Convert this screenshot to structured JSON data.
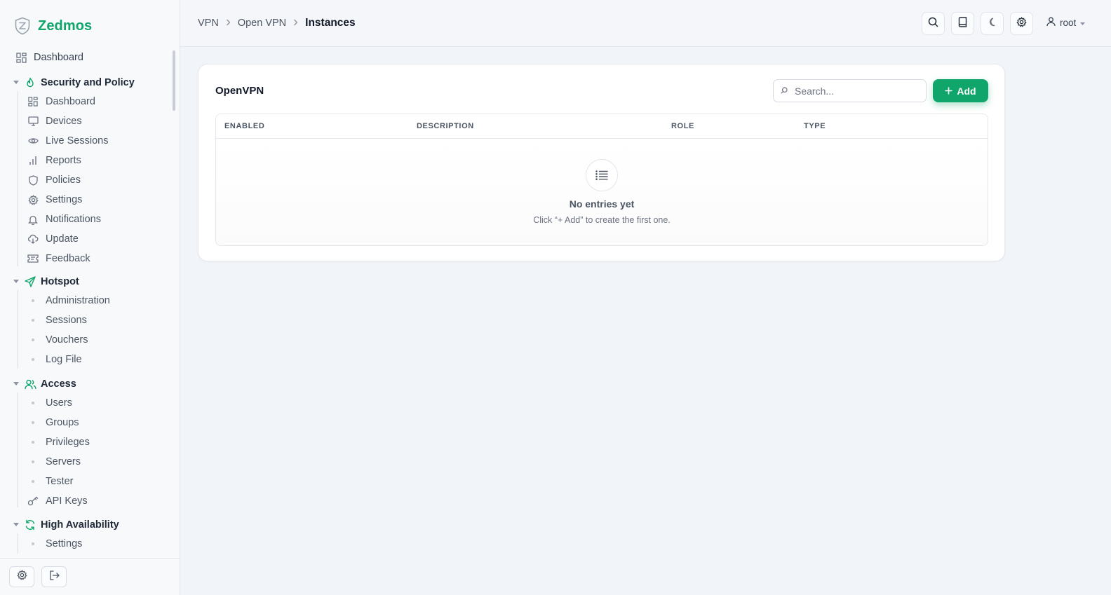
{
  "brand": {
    "name": "Zedmos",
    "accent": "#10a66b"
  },
  "sidebar": {
    "top_items": [
      {
        "label": "Dashboard",
        "icon": "grid-icon"
      }
    ],
    "groups": [
      {
        "label": "Security and Policy",
        "icon": "flame-icon",
        "items": [
          {
            "label": "Dashboard",
            "icon": "grid-icon"
          },
          {
            "label": "Devices",
            "icon": "monitor-icon"
          },
          {
            "label": "Live Sessions",
            "icon": "eye-icon"
          },
          {
            "label": "Reports",
            "icon": "bar-chart-icon"
          },
          {
            "label": "Policies",
            "icon": "shield-icon"
          },
          {
            "label": "Settings",
            "icon": "gear-icon"
          },
          {
            "label": "Notifications",
            "icon": "bell-icon"
          },
          {
            "label": "Update",
            "icon": "cloud-download-icon"
          },
          {
            "label": "Feedback",
            "icon": "ticket-icon"
          }
        ]
      },
      {
        "label": "Hotspot",
        "icon": "send-icon",
        "items": [
          {
            "label": "Administration"
          },
          {
            "label": "Sessions"
          },
          {
            "label": "Vouchers"
          },
          {
            "label": "Log File"
          }
        ]
      },
      {
        "label": "Access",
        "icon": "users-icon",
        "items": [
          {
            "label": "Users"
          },
          {
            "label": "Groups"
          },
          {
            "label": "Privileges"
          },
          {
            "label": "Servers"
          },
          {
            "label": "Tester"
          },
          {
            "label": "API Keys",
            "icon": "key-icon"
          }
        ]
      },
      {
        "label": "High Availability",
        "icon": "refresh-icon",
        "items": [
          {
            "label": "Settings"
          }
        ]
      }
    ],
    "footer": {
      "settings_icon": "gear-icon",
      "logout_icon": "logout-icon"
    }
  },
  "topbar": {
    "breadcrumb": [
      "VPN",
      "Open VPN",
      "Instances"
    ],
    "actions": [
      "search-icon",
      "book-icon",
      "moon-icon",
      "gear-icon"
    ],
    "user": "root"
  },
  "card": {
    "title": "OpenVPN",
    "search_placeholder": "Search...",
    "add_label": "Add",
    "columns": [
      "ENABLED",
      "DESCRIPTION",
      "ROLE",
      "TYPE"
    ],
    "empty_title": "No entries yet",
    "empty_subtitle": "Click “+ Add” to create the first one."
  }
}
